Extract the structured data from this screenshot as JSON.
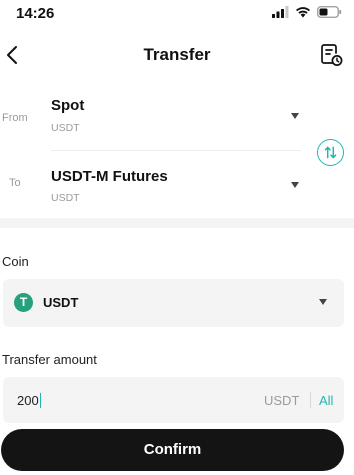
{
  "status_bar": {
    "time": "14:26",
    "icons": [
      "signal-icon",
      "wifi-icon",
      "battery-icon"
    ]
  },
  "nav": {
    "title": "Transfer",
    "back_icon": "chevron-left-icon",
    "record_icon": "document-clock-icon"
  },
  "transfer": {
    "from_label": "From",
    "from_account": "Spot",
    "from_sub": "USDT",
    "to_label": "To",
    "to_account": "USDT-M Futures",
    "to_sub": "USDT",
    "swap_icon": "swap-vertical-icon"
  },
  "coin": {
    "label": "Coin",
    "selected": "USDT",
    "icon": "tether-icon",
    "icon_glyph": "T"
  },
  "amount": {
    "label": "Transfer amount",
    "value": "200",
    "unit": "USDT",
    "all_label": "All"
  },
  "confirm_label": "Confirm",
  "colors": {
    "accent": "#22b8b0",
    "tether": "#26a17b",
    "button": "#141414",
    "field_bg": "#f4f4f5"
  }
}
